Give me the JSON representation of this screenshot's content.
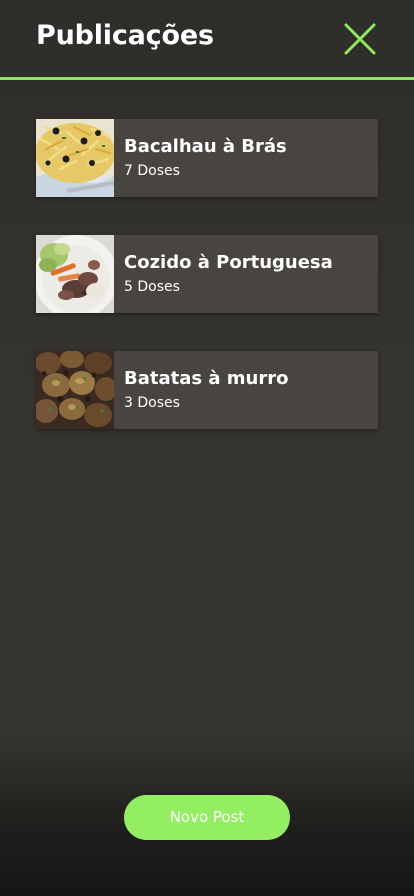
{
  "header": {
    "title": "Publicações",
    "close_icon": "close-icon",
    "accent_color": "#8fe85f"
  },
  "posts": [
    {
      "title": "Bacalhau à Brás",
      "doses": "7 Doses",
      "thumbnail": "bacalhau-photo"
    },
    {
      "title": "Cozido à Portuguesa",
      "doses": "5 Doses",
      "thumbnail": "cozido-photo"
    },
    {
      "title": "Batatas à murro",
      "doses": "3 Doses",
      "thumbnail": "batatas-photo"
    }
  ],
  "actions": {
    "new_post_label": "Novo Post",
    "button_color": "#93ee61"
  }
}
